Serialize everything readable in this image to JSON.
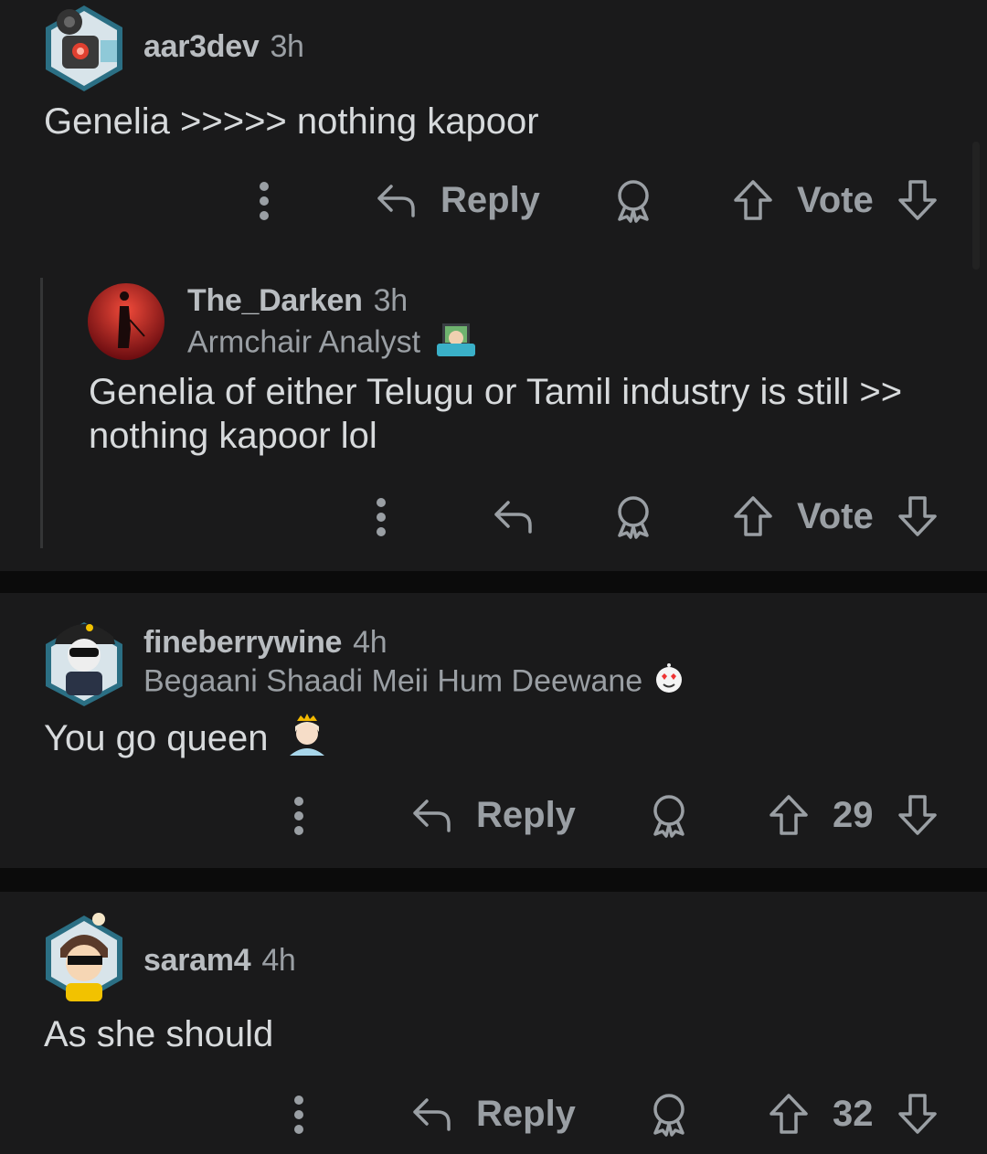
{
  "comments": [
    {
      "username": "aar3dev",
      "time": "3h",
      "body": "Genelia >>>>> nothing kapoor",
      "reply_label": "Reply",
      "vote_label": "Vote"
    },
    {
      "username": "The_Darken",
      "time": "3h",
      "flair": "Armchair Analyst",
      "body_line1": "Genelia of either Telugu or Tamil industry is still >>",
      "body_line2": "nothing kapoor lol",
      "vote_label": "Vote"
    },
    {
      "username": "fineberrywine",
      "time": "4h",
      "flair": "Begaani Shaadi Meii Hum Deewane",
      "body": "You go queen",
      "reply_label": "Reply",
      "vote_count": "29"
    },
    {
      "username": "saram4",
      "time": "4h",
      "body": "As she should",
      "reply_label": "Reply",
      "vote_count": "32"
    }
  ],
  "icons": {
    "more": "more-vertical-icon",
    "reply": "reply-arrow-icon",
    "award": "award-icon",
    "upvote": "upvote-arrow-icon",
    "downvote": "downvote-arrow-icon"
  },
  "colors": {
    "background": "#0b0b0b",
    "card": "#1a1a1b",
    "text": "#d7dadc",
    "muted": "#9a9fa4"
  }
}
